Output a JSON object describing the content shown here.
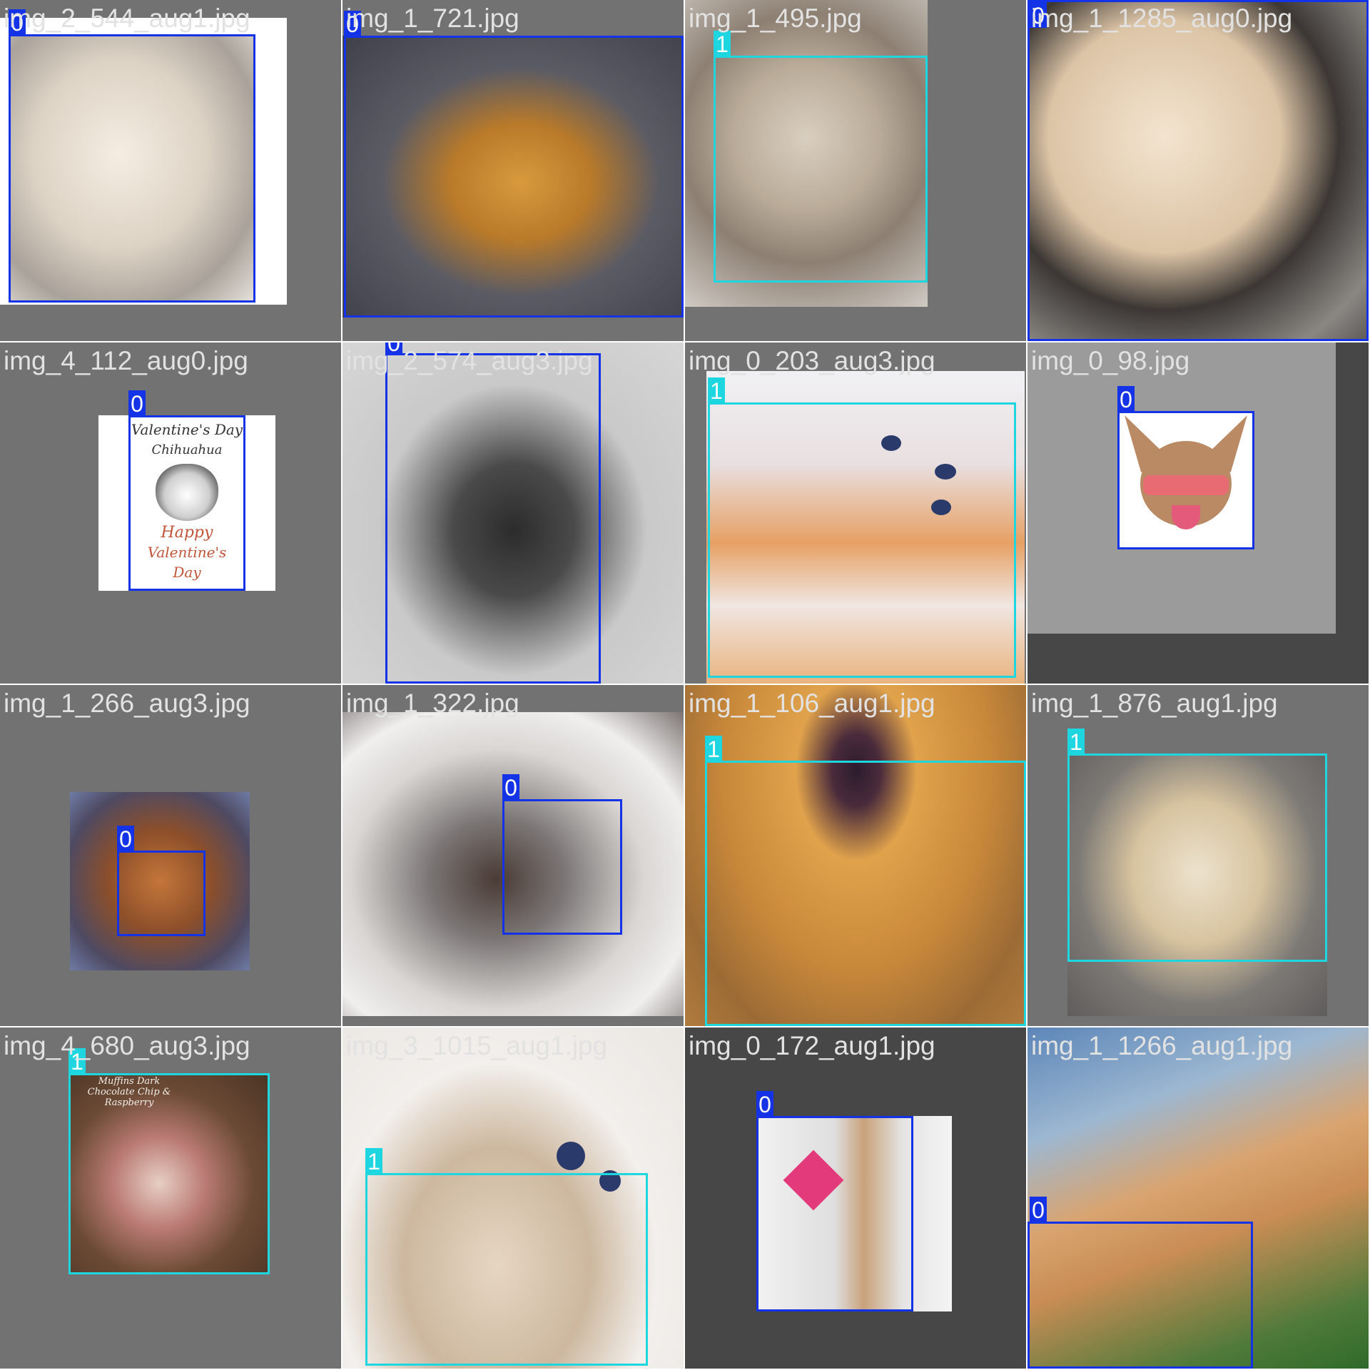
{
  "colors": {
    "class0": "#1433e6",
    "class1": "#1ed6df",
    "tile_bg": "#727272",
    "filename_text": "#e2e2e2"
  },
  "tiles": [
    {
      "filename": "img_2_544_aug1.jpg",
      "label": "0"
    },
    {
      "filename": "img_1_721.jpg",
      "label": "0"
    },
    {
      "filename": "img_1_495.jpg",
      "label": "1"
    },
    {
      "filename": "img_1_1285_aug0.jpg",
      "label": "0"
    },
    {
      "filename": "img_4_112_aug0.jpg",
      "label": "0"
    },
    {
      "filename": "img_2_574_aug3.jpg",
      "label": "0"
    },
    {
      "filename": "img_0_203_aug3.jpg",
      "label": "1"
    },
    {
      "filename": "img_0_98.jpg",
      "label": "0"
    },
    {
      "filename": "img_1_266_aug3.jpg",
      "label": "0"
    },
    {
      "filename": "img_1_322.jpg",
      "label": "0"
    },
    {
      "filename": "img_1_106_aug1.jpg",
      "label": "1"
    },
    {
      "filename": "img_1_876_aug1.jpg",
      "label": "1"
    },
    {
      "filename": "img_4_680_aug3.jpg",
      "label": "1"
    },
    {
      "filename": "img_3_1015_aug1.jpg",
      "label": "1"
    },
    {
      "filename": "img_0_172_aug1.jpg",
      "label": "0"
    },
    {
      "filename": "img_1_1266_aug1.jpg",
      "label": "0"
    }
  ],
  "card": {
    "line1": "Valentine's Day",
    "line2": "Chihuahua",
    "line3": "Happy",
    "line4": "Valentine's",
    "line5": "Day"
  },
  "muffin_card_text": "Muffins Dark Chocolate Chip & Raspberry"
}
